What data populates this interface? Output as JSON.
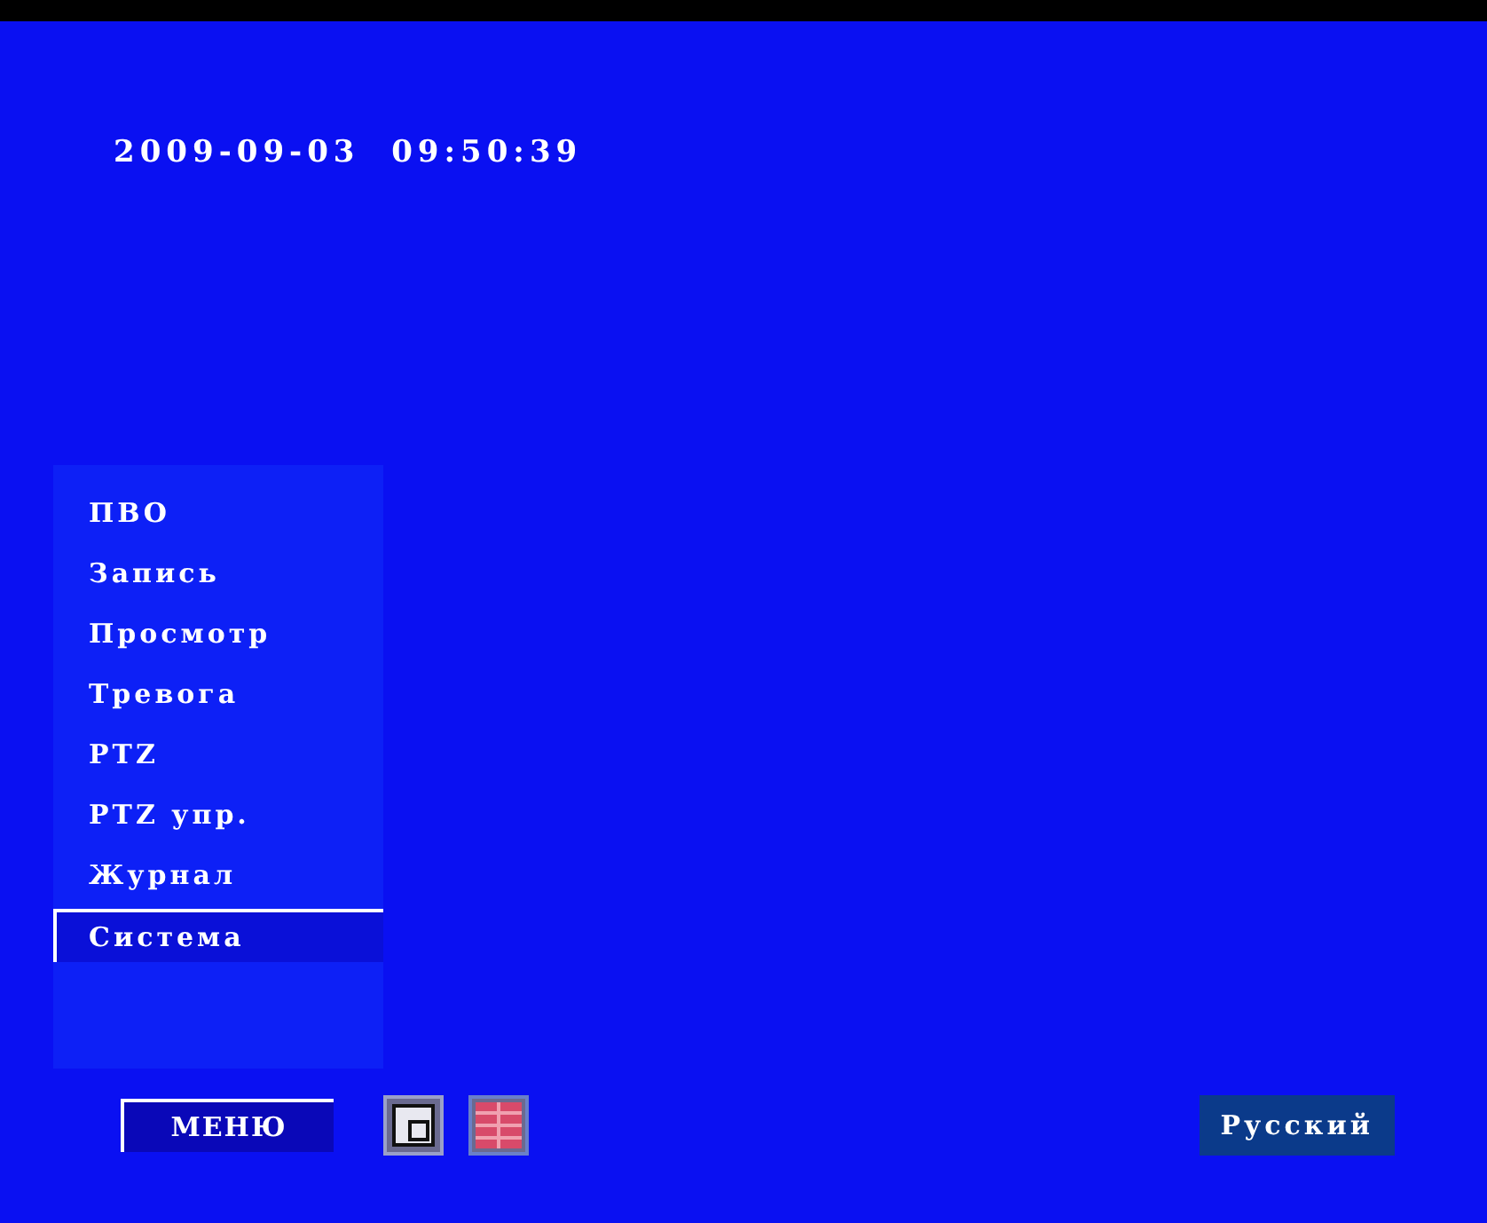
{
  "datetime": "2009-09-03  09:50:39",
  "menu": {
    "items": [
      {
        "label": "ПВО",
        "selected": false
      },
      {
        "label": "Запись",
        "selected": false
      },
      {
        "label": "Просмотр",
        "selected": false
      },
      {
        "label": "Тревога",
        "selected": false
      },
      {
        "label": "PTZ",
        "selected": false
      },
      {
        "label": "PTZ упр.",
        "selected": false
      },
      {
        "label": "Журнал",
        "selected": false
      },
      {
        "label": "Система",
        "selected": true
      }
    ]
  },
  "bottom_bar": {
    "menu_button": "МЕНЮ",
    "layouts": [
      {
        "kind": "single",
        "selected": true
      },
      {
        "kind": "quad",
        "selected": false
      }
    ],
    "language": "Русский"
  }
}
